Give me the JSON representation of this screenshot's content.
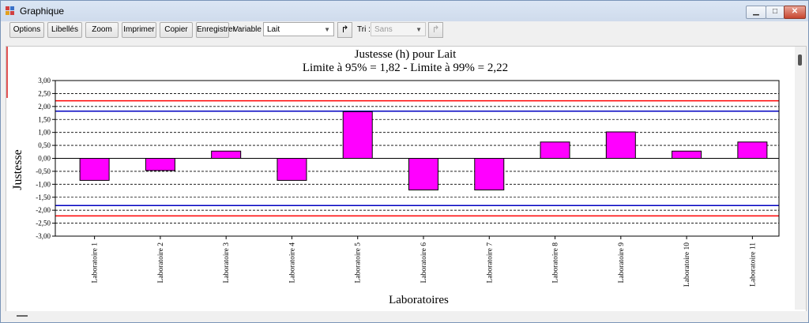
{
  "window": {
    "title": "Graphique"
  },
  "toolbar": {
    "options": "Options",
    "libelles": "Libellés",
    "zoom": "Zoom",
    "imprimer": "Imprimer",
    "copier": "Copier",
    "enregistrer": "Enregistrer",
    "variable_label": "Variable :",
    "variable_value": "Lait",
    "tri_label": "Tri :",
    "tri_value": "Sans"
  },
  "chart_data": {
    "type": "bar",
    "title": "Justesse (h) pour Lait",
    "subtitle": "Limite à 95% = 1,82 - Limite à 99% = 2,22",
    "xlabel": "Laboratoires",
    "ylabel": "Justesse",
    "categories": [
      "Laboratoire 1",
      "Laboratoire 2",
      "Laboratoire 3",
      "Laboratoire 4",
      "Laboratoire 5",
      "Laboratoire 6",
      "Laboratoire 7",
      "Laboratoire 8",
      "Laboratoire 9",
      "Laboratoire 10",
      "Laboratoire 11"
    ],
    "values": [
      -0.85,
      -0.47,
      0.28,
      -0.85,
      1.8,
      -1.22,
      -1.22,
      0.63,
      1.02,
      0.28,
      0.63
    ],
    "ylim": [
      -3,
      3
    ],
    "yticks": [
      "-3,00",
      "-2,50",
      "-2,00",
      "-1,50",
      "-1,00",
      "-0,50",
      "0,00",
      "0,50",
      "1,00",
      "1,50",
      "2,00",
      "2,50",
      "3,00"
    ],
    "reference_lines": [
      {
        "value": 2.22,
        "color": "#ff0000"
      },
      {
        "value": 1.82,
        "color": "#0000c0"
      },
      {
        "value": -1.82,
        "color": "#0000c0"
      },
      {
        "value": -2.22,
        "color": "#ff0000"
      }
    ],
    "bar_color": "#ff00ff",
    "grid": true
  }
}
